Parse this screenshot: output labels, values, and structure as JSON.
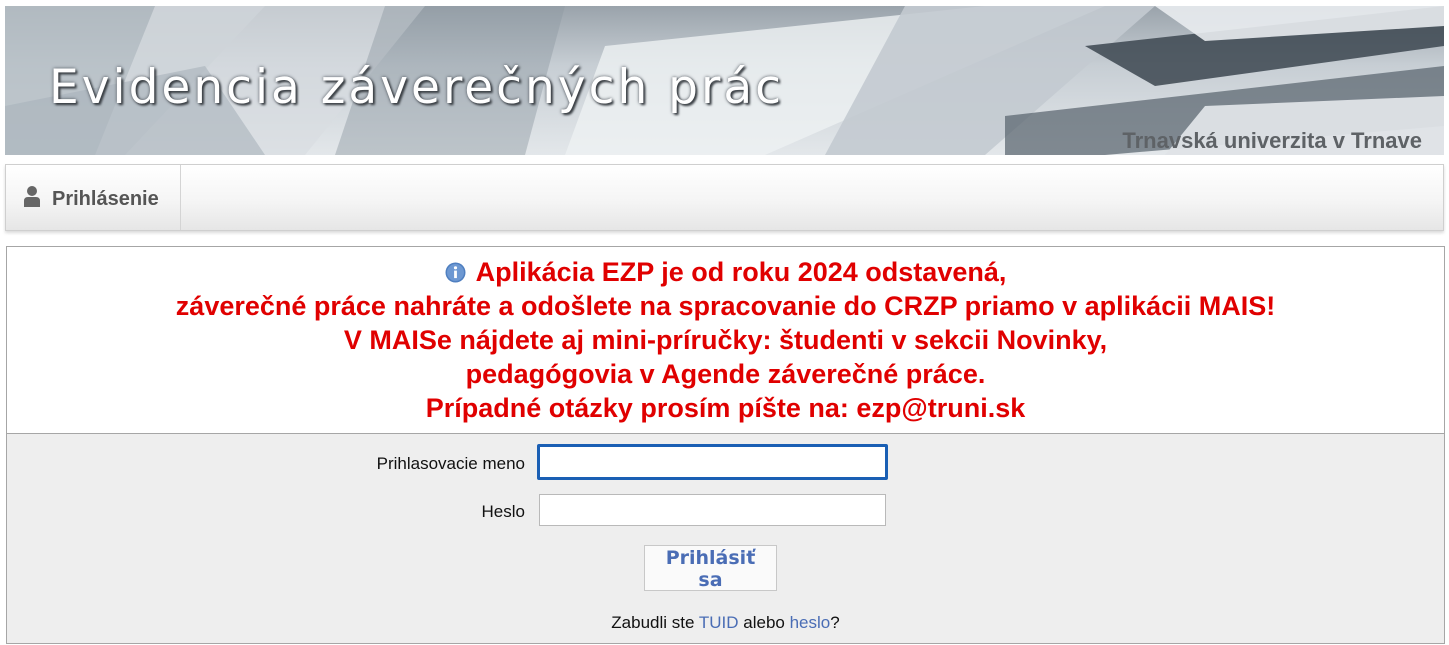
{
  "header": {
    "title": "Evidencia záverečných prác",
    "university": "Trnavská univerzita v Trnave"
  },
  "nav": {
    "items": [
      {
        "label": "Prihlásenie",
        "icon": "user-icon"
      }
    ]
  },
  "notice": {
    "icon": "info-icon",
    "color": "#e00000",
    "lines": [
      "Aplikácia EZP je od roku 2024 odstavená,",
      "záverečné práce nahráte a odošlete na spracovanie do CRZP priamo v aplikácii MAIS!",
      "V MAISe nájdete aj mini-príručky: študenti v sekcii Novinky,",
      "pedagógovia v Agende záverečné práce.",
      "Prípadné otázky prosím píšte na: ezp@truni.sk"
    ]
  },
  "login": {
    "username_label": "Prihlasovacie meno",
    "username_value": "",
    "password_label": "Heslo",
    "password_value": "",
    "submit_label": "Prihlásiť sa",
    "forgot": {
      "prefix": "Zabudli ste ",
      "tuid_link": "TUID",
      "middle": " alebo ",
      "password_link": "heslo",
      "suffix": "?"
    }
  },
  "colors": {
    "accent_link": "#4a6db5",
    "notice_red": "#e00000",
    "focus_border": "#1a5fb4"
  }
}
